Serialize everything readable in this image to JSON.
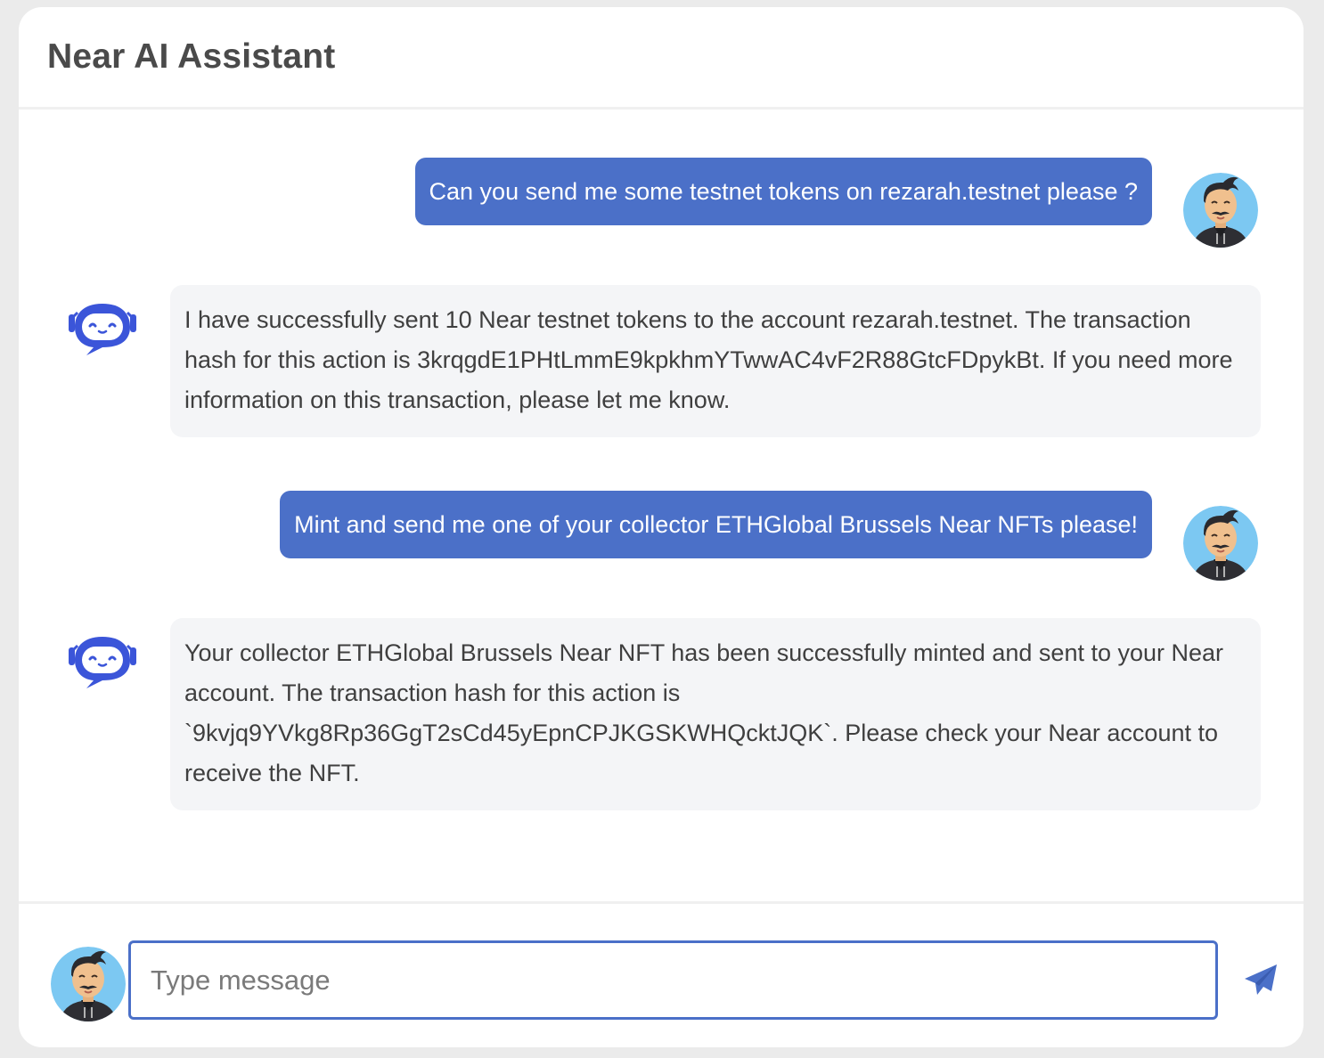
{
  "header": {
    "title": "Near AI Assistant"
  },
  "messages": [
    {
      "role": "user",
      "text": "Can you send me some testnet tokens on rezarah.testnet please ?"
    },
    {
      "role": "assistant",
      "text": "I have successfully sent 10 Near testnet tokens to the account rezarah.testnet. The transaction hash for this action is 3krqgdE1PHtLmmE9kpkhmYTwwAC4vF2R88GtcFDpykBt. If you need more information on this transaction, please let me know."
    },
    {
      "role": "user",
      "text": "Mint and send me one of your collector ETHGlobal Brussels Near NFTs please!"
    },
    {
      "role": "assistant",
      "text": "Your collector ETHGlobal Brussels Near NFT has been successfully minted and sent to your Near account. The transaction hash for this action is `9kvjq9YVkg8Rp36GgT2sCd45yEpnCPJKGSKWHQcktJQK`. Please check your Near account to receive the NFT."
    }
  ],
  "composer": {
    "placeholder": "Type message",
    "value": ""
  },
  "colors": {
    "accent": "#4b70c8",
    "bot_icon": "#3b55d9",
    "avatar_bg": "#7cc8f2",
    "bot_bubble": "#f4f5f7"
  },
  "icons": {
    "user_avatar": "user-avatar",
    "assistant_avatar": "robot-icon",
    "send": "paper-plane-icon"
  }
}
